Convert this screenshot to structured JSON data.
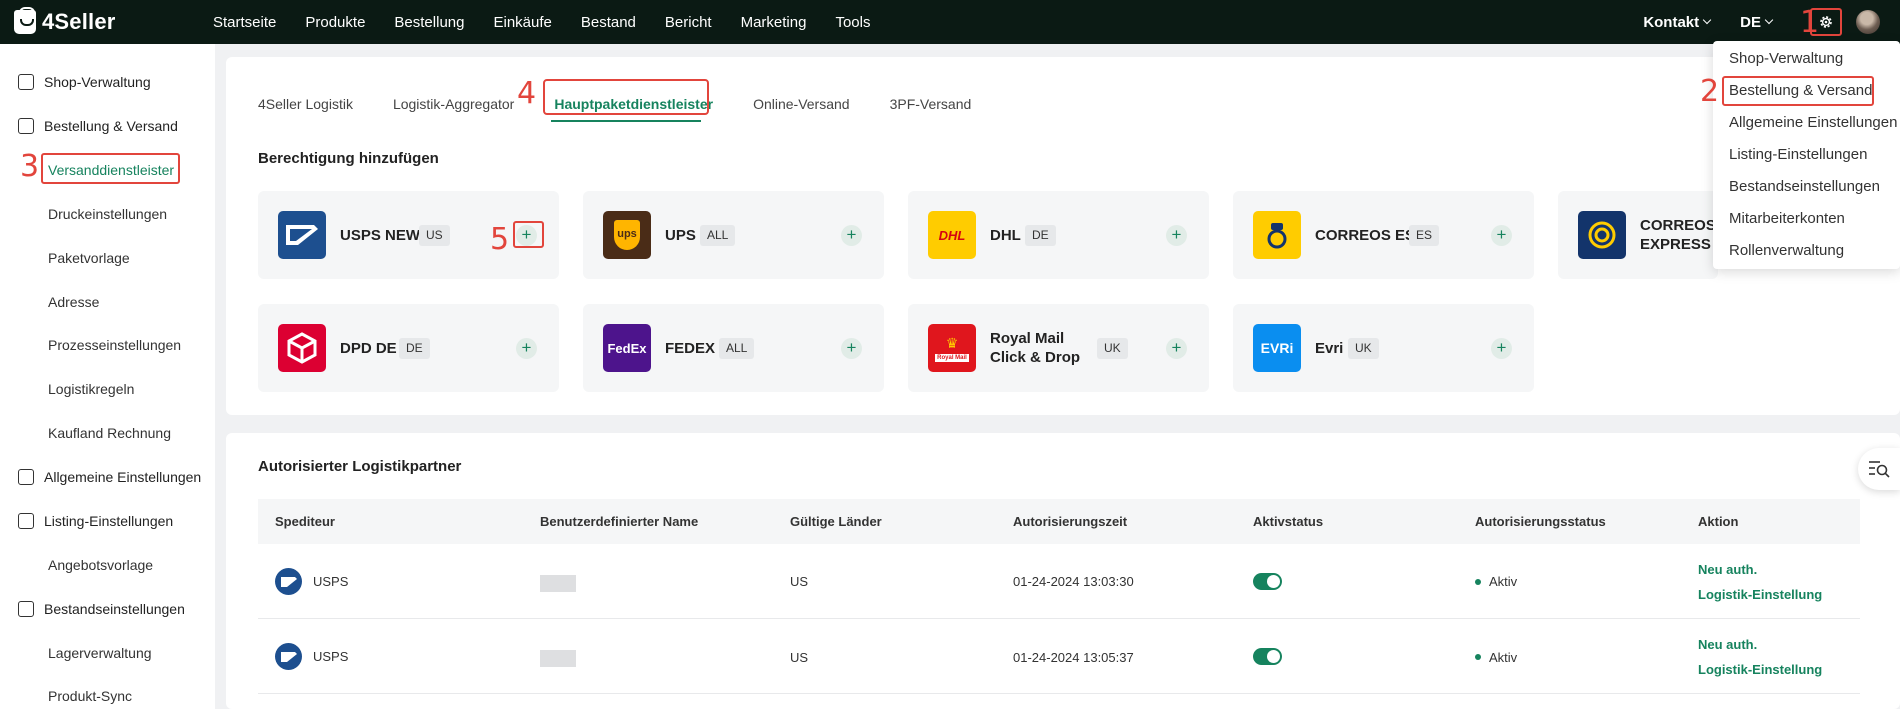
{
  "app": {
    "name": "4Seller"
  },
  "nav": [
    "Startseite",
    "Produkte",
    "Bestellung",
    "Einkäufe",
    "Bestand",
    "Bericht",
    "Marketing",
    "Tools"
  ],
  "topright": {
    "contact": "Kontakt",
    "lang": "DE"
  },
  "annotations": [
    "1",
    "2",
    "3",
    "4",
    "5"
  ],
  "sidebar": {
    "items": [
      {
        "label": "Shop-Verwaltung",
        "type": "main"
      },
      {
        "label": "Bestellung & Versand",
        "type": "main"
      },
      {
        "label": "Versanddienstleister",
        "type": "sub",
        "active": true
      },
      {
        "label": "Druckeinstellungen",
        "type": "sub"
      },
      {
        "label": "Paketvorlage",
        "type": "sub"
      },
      {
        "label": "Adresse",
        "type": "sub"
      },
      {
        "label": "Prozesseinstellungen",
        "type": "sub"
      },
      {
        "label": "Logistikregeln",
        "type": "sub"
      },
      {
        "label": "Kaufland Rechnung",
        "type": "sub"
      },
      {
        "label": "Allgemeine Einstellungen",
        "type": "main"
      },
      {
        "label": "Listing-Einstellungen",
        "type": "main"
      },
      {
        "label": "Angebotsvorlage",
        "type": "sub"
      },
      {
        "label": "Bestandseinstellungen",
        "type": "main"
      },
      {
        "label": "Lagerverwaltung",
        "type": "sub"
      },
      {
        "label": "Produkt-Sync",
        "type": "sub"
      }
    ]
  },
  "tabs": [
    "4Seller Logistik",
    "Logistik-Aggregator",
    "Hauptpaketdienstleister",
    "Online-Versand",
    "3PF-Versand"
  ],
  "section_add": "Berechtigung hinzufügen",
  "carriers": [
    {
      "name": "USPS NEW",
      "badge": "US",
      "logo_text": "",
      "color": "#1d4f8f"
    },
    {
      "name": "UPS",
      "badge": "ALL",
      "logo_text": "ups",
      "color": "#4a2c17"
    },
    {
      "name": "DHL",
      "badge": "DE",
      "logo_text": "DHL",
      "color": "#ffcc00"
    },
    {
      "name": "CORREOS ES",
      "badge": "ES",
      "logo_text": "",
      "color": "#ffcc00"
    },
    {
      "name": "CORREOS EXPRESS",
      "badge": "",
      "logo_text": "",
      "color": "#13346b"
    },
    {
      "name": "DPD DE",
      "badge": "DE",
      "logo_text": "",
      "color": "#dc0032"
    },
    {
      "name": "FEDEX",
      "badge": "ALL",
      "logo_text": "FedEx",
      "color": "#4d148c"
    },
    {
      "name": "Royal Mail Click & Drop",
      "badge": "UK",
      "logo_text": "Royal Mail",
      "color": "#e0161d"
    },
    {
      "name": "Evri",
      "badge": "UK",
      "logo_text": "EVRi",
      "color": "#0a8ef0"
    }
  ],
  "dropdown": [
    "Shop-Verwaltung",
    "Bestellung & Versand",
    "Allgemeine Einstellungen",
    "Listing-Einstellungen",
    "Bestandseinstellungen",
    "Mitarbeiterkonten",
    "Rollenverwaltung"
  ],
  "section_partner": "Autorisierter Logistikpartner",
  "table": {
    "headers": [
      "Spediteur",
      "Benutzerdefinierter Name",
      "Gültige Länder",
      "Autorisierungszeit",
      "Aktivstatus",
      "Autorisierungsstatus",
      "Aktion"
    ],
    "rows": [
      {
        "carrier": "USPS",
        "country": "US",
        "time": "01-24-2024 13:03:30",
        "status": "Aktiv",
        "action1": "Neu auth.",
        "action2": "Logistik-Einstellung"
      },
      {
        "carrier": "USPS",
        "country": "US",
        "time": "01-24-2024 13:05:37",
        "status": "Aktiv",
        "action1": "Neu auth.",
        "action2": "Logistik-Einstellung"
      }
    ]
  },
  "colors": {
    "accent": "#16835e",
    "topbar": "#0b1a14",
    "annotation": "#e2453c"
  }
}
